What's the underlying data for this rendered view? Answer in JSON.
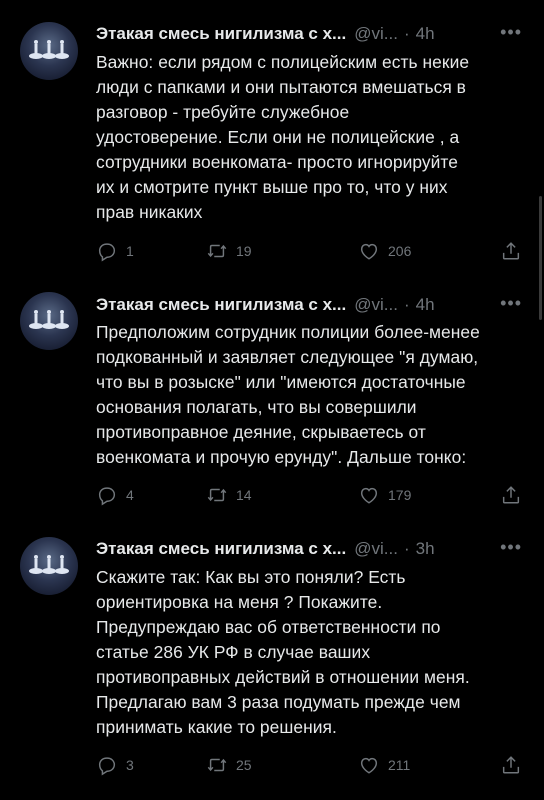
{
  "tweets": [
    {
      "author": "Этакая смесь нигилизма с х...",
      "handle": "@vi...",
      "time": "4h",
      "more": "•••",
      "text": "Важно: если рядом с полицейским есть некие\nлюди с папками и они пытаются вмешаться в\nразговор - требуйте служебное\nудостоверение. Если они не полицейские , а\nсотрудники военкомата- просто игнорируйте\nих и смотрите пункт выше про то, что у них\nправ никаких",
      "replies": "1",
      "retweets": "19",
      "likes": "206"
    },
    {
      "author": "Этакая смесь нигилизма с х...",
      "handle": "@vi...",
      "time": "4h",
      "more": "•••",
      "text": "Предположим сотрудник полиции более-менее\nподкованный и заявляет следующее \"я думаю,\nчто вы в розыске\" или \"имеются достаточные\nоснования полагать, что вы совершили\nпротивоправное деяние, скрываетесь от\nвоенкомата и прочую ерунду\". Дальше тонко:",
      "replies": "4",
      "retweets": "14",
      "likes": "179"
    },
    {
      "author": "Этакая смесь нигилизма с х...",
      "handle": "@vi...",
      "time": "3h",
      "more": "•••",
      "text": "Скажите так: Как вы это поняли? Есть\nориентировка на меня ? Покажите.\nПредупреждаю вас об ответственности по\nстатье 286 УК РФ в случае ваших\nпротивоправных действий в отношении меня.\nПредлагаю вам 3 раза подумать прежде чем\nпринимать какие то решения.",
      "replies": "3",
      "retweets": "25",
      "likes": "211"
    }
  ],
  "icons": {
    "reply": "reply-icon",
    "retweet": "retweet-icon",
    "like": "heart-icon",
    "share": "share-icon",
    "more": "more-icon"
  },
  "colors": {
    "background": "#000000",
    "text": "#e7e9ea",
    "secondary": "#71767b"
  }
}
